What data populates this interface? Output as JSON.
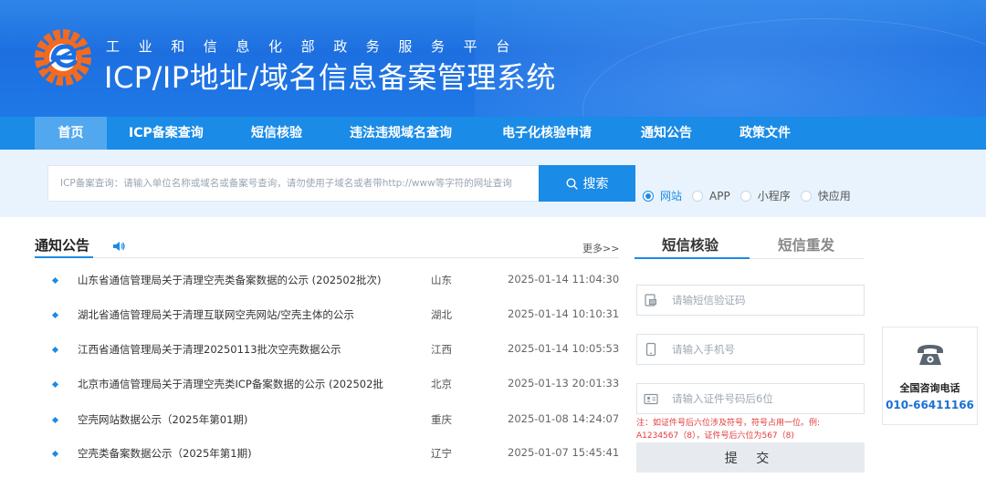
{
  "header": {
    "subtitle": "工业和信息化部政务服务平台",
    "title": "ICP/IP地址/域名信息备案管理系统"
  },
  "nav": {
    "items": [
      {
        "label": "首页",
        "active": true
      },
      {
        "label": "ICP备案查询"
      },
      {
        "label": "短信核验"
      },
      {
        "label": "违法违规域名查询"
      },
      {
        "label": "电子化核验申请"
      },
      {
        "label": "通知公告"
      },
      {
        "label": "政策文件"
      }
    ]
  },
  "search": {
    "placeholder": "ICP备案查询：请输入单位名称或域名或备案号查询，请勿使用子域名或者带http://www等字符的网址查询",
    "button_label": "搜索",
    "options": [
      {
        "label": "网站",
        "checked": true
      },
      {
        "label": "APP"
      },
      {
        "label": "小程序"
      },
      {
        "label": "快应用"
      }
    ]
  },
  "notices": {
    "title": "通知公告",
    "more": "更多>>",
    "items": [
      {
        "title": "山东省通信管理局关于清理空壳类备案数据的公示 (202502批次)",
        "province": "山东",
        "date": "2025-01-14 11:04:30"
      },
      {
        "title": "湖北省通信管理局关于清理互联网空壳网站/空壳主体的公示",
        "province": "湖北",
        "date": "2025-01-14 10:10:31"
      },
      {
        "title": "江西省通信管理局关于清理20250113批次空壳数据公示",
        "province": "江西",
        "date": "2025-01-14 10:05:53"
      },
      {
        "title": "北京市通信管理局关于清理空壳类ICP备案数据的公示 (202502批",
        "province": "北京",
        "date": "2025-01-13 20:01:33"
      },
      {
        "title": "空壳网站数据公示（2025年第01期)",
        "province": "重庆",
        "date": "2025-01-08 14:24:07"
      },
      {
        "title": "空壳类备案数据公示（2025年第1期)",
        "province": "辽宁",
        "date": "2025-01-07 15:45:41"
      }
    ]
  },
  "sms": {
    "tab_verify": "短信核验",
    "tab_resend": "短信重发",
    "code_placeholder": "请输短信验证码",
    "phone_placeholder": "请输入手机号",
    "id_placeholder": "请输入证件号码后6位",
    "note": "注：如证件号后六位涉及符号，符号占用一位。例: A1234567（8），证件号后六位为567（8)",
    "submit_label": "提 交"
  },
  "contact": {
    "label": "全国咨询电话",
    "phone": "010-66411166"
  },
  "colors": {
    "primary": "#1a8be6",
    "header": "#1d6fe0",
    "note_red": "#e23a3a"
  }
}
